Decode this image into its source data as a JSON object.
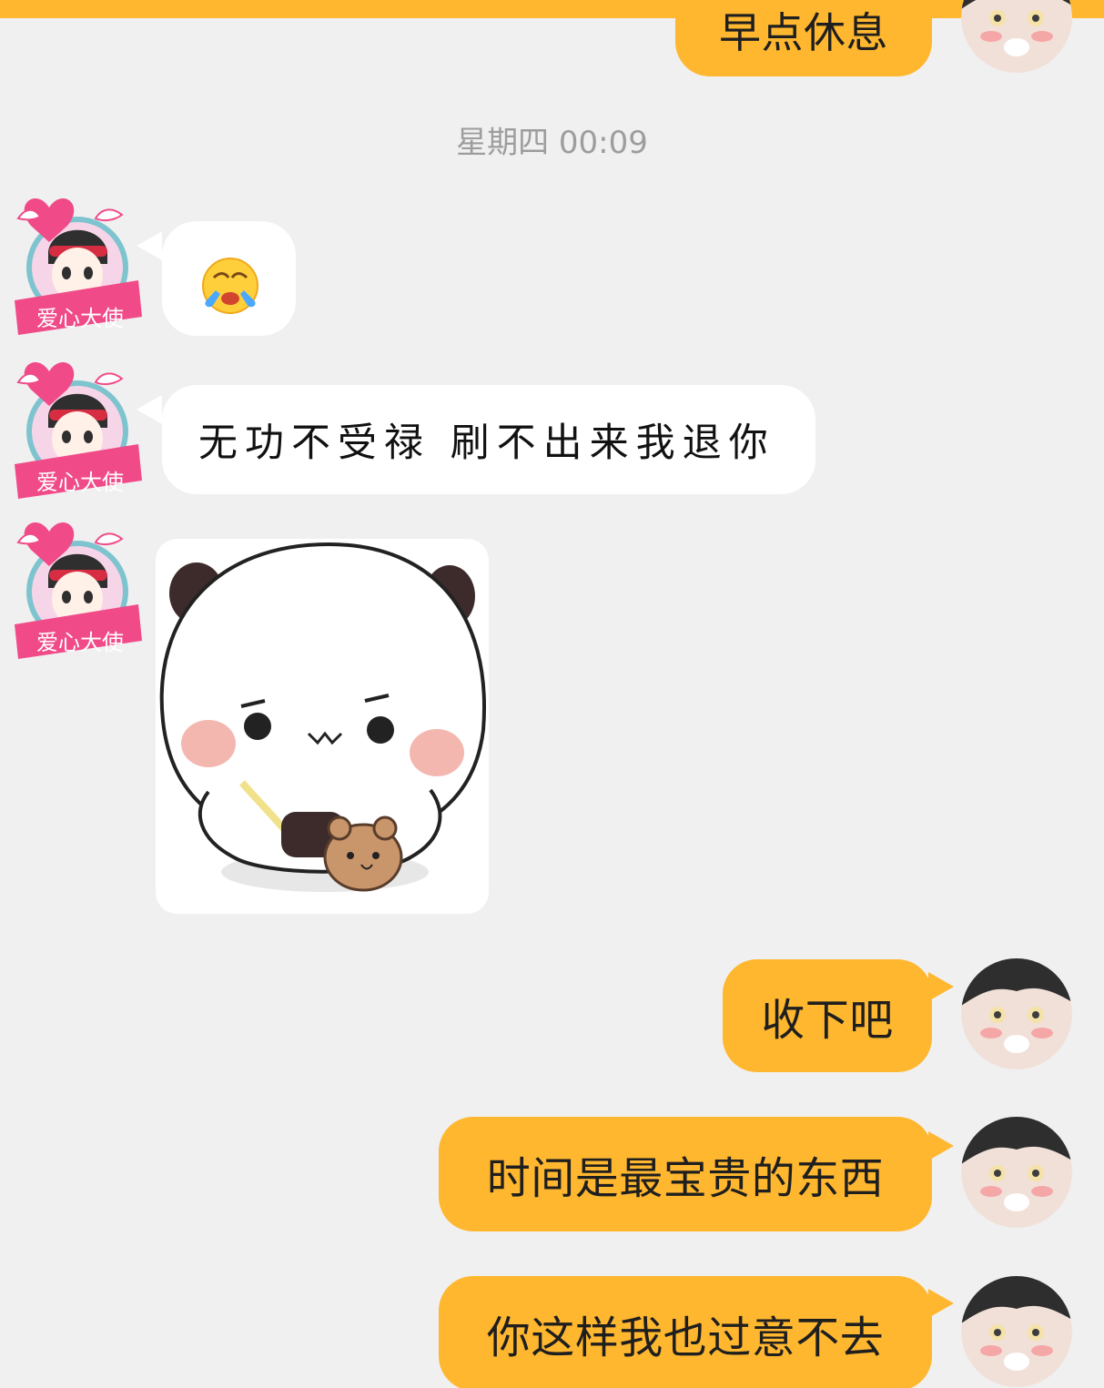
{
  "header": {
    "accent_color": "#ffb72f",
    "partial_previous_message": "早点休息"
  },
  "chat": {
    "timestamp": "星期四 00:09",
    "messages": [
      {
        "side": "left",
        "type": "emoji",
        "emoji": "😭"
      },
      {
        "side": "left",
        "type": "text",
        "text": "无功不受禄 刷不出来我退你"
      },
      {
        "side": "left",
        "type": "sticker",
        "sticker_icon": "panda-sticker-icon"
      },
      {
        "side": "right",
        "type": "text",
        "text": "收下吧"
      },
      {
        "side": "right",
        "type": "text",
        "text": "时间是最宝贵的东西"
      },
      {
        "side": "right",
        "type": "text",
        "text": "你这样我也过意不去"
      }
    ]
  },
  "avatars": {
    "left_badge_text": "爱心大使",
    "left_icon": "heart-badge-avatar-icon",
    "right_icon": "anime-avatar-icon"
  },
  "colors": {
    "background": "#f0f0f0",
    "left_bubble": "#ffffff",
    "right_bubble": "#ffb72f",
    "timestamp_text": "#9d9d9d",
    "badge_pink": "#f04b88"
  }
}
